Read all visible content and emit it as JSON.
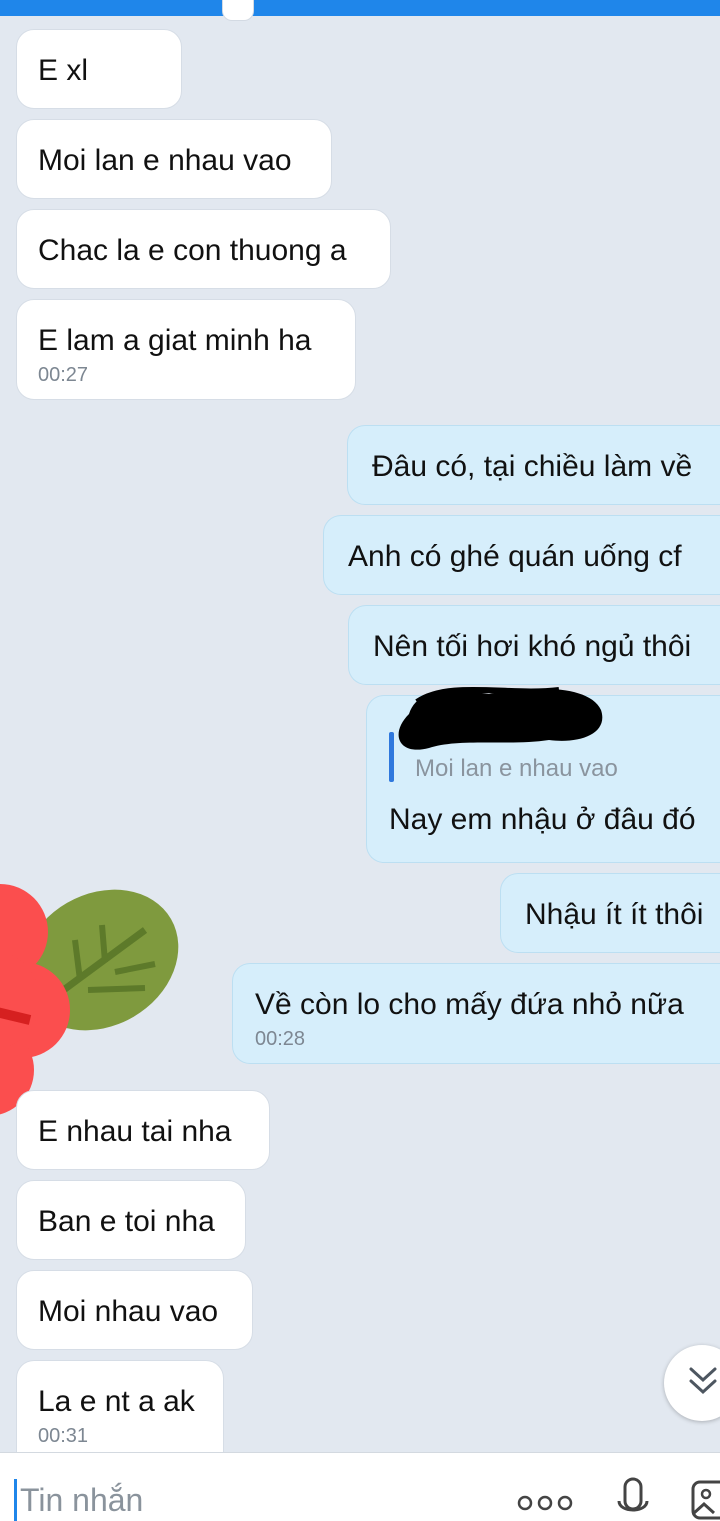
{
  "input": {
    "placeholder": "Tin nhắn"
  },
  "messages": [
    {
      "side": "in",
      "text": "E xl"
    },
    {
      "side": "in",
      "text": "Moi lan e nhau vao"
    },
    {
      "side": "in",
      "text": "Chac la e con thuong a"
    },
    {
      "side": "in",
      "text": "E lam a giat minh ha",
      "time": "00:27"
    },
    {
      "side": "out",
      "text": "Đâu có, tại chiều làm về"
    },
    {
      "side": "out",
      "text": "Anh có ghé quán uống cf"
    },
    {
      "side": "out",
      "text": "Nên tối hơi khó ngủ thôi"
    },
    {
      "side": "out",
      "quote": "Moi lan e nhau vao",
      "text": "Nay em nhậu ở đâu đó"
    },
    {
      "side": "out",
      "text": "Nhậu ít ít thôi"
    },
    {
      "side": "out",
      "text": "Về còn lo cho mấy đứa nhỏ nữa",
      "time": "00:28"
    },
    {
      "side": "in",
      "text": "E nhau tai nha"
    },
    {
      "side": "in",
      "text": "Ban e toi nha"
    },
    {
      "side": "in",
      "text": "Moi nhau vao"
    },
    {
      "side": "in",
      "text": "La e nt a ak",
      "time": "00:31"
    }
  ]
}
